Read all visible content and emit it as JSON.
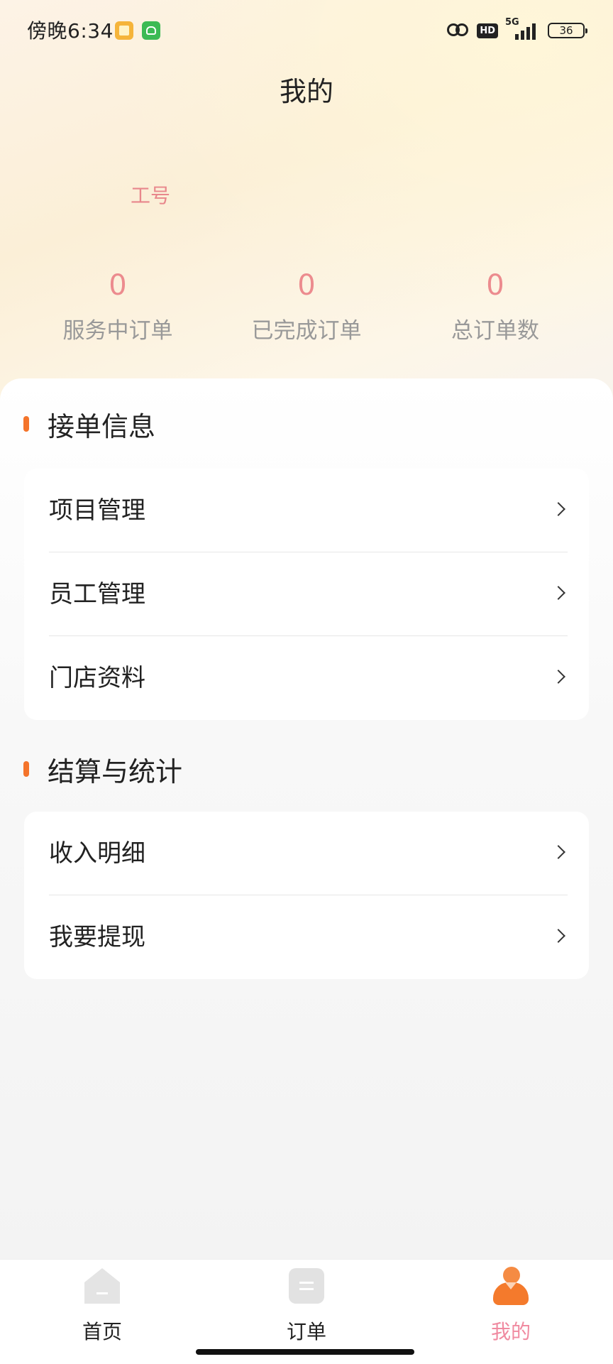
{
  "status_bar": {
    "time": "傍晚6:34",
    "hd": "HD",
    "network": "5G",
    "battery": "36"
  },
  "page": {
    "title": "我的"
  },
  "profile": {
    "worker_id_label": "工号"
  },
  "stats": [
    {
      "value": "0",
      "label": "服务中订单"
    },
    {
      "value": "0",
      "label": "已完成订单"
    },
    {
      "value": "0",
      "label": "总订单数"
    }
  ],
  "sections": [
    {
      "title": "接单信息",
      "items": [
        {
          "label": "项目管理"
        },
        {
          "label": "员工管理"
        },
        {
          "label": "门店资料"
        }
      ]
    },
    {
      "title": "结算与统计",
      "items": [
        {
          "label": "收入明细"
        },
        {
          "label": "我要提现"
        }
      ]
    }
  ],
  "tabbar": {
    "items": [
      {
        "label": "首页"
      },
      {
        "label": "订单"
      },
      {
        "label": "我的"
      }
    ],
    "active_index": 2
  },
  "colors": {
    "accent": "#f4742b",
    "stat_value": "#ec8b8e",
    "active_tab": "#f08aa0"
  },
  "icons": {
    "chevron": "chevron-right-icon",
    "home": "home-icon",
    "orders": "orders-icon",
    "me": "profile-icon"
  }
}
